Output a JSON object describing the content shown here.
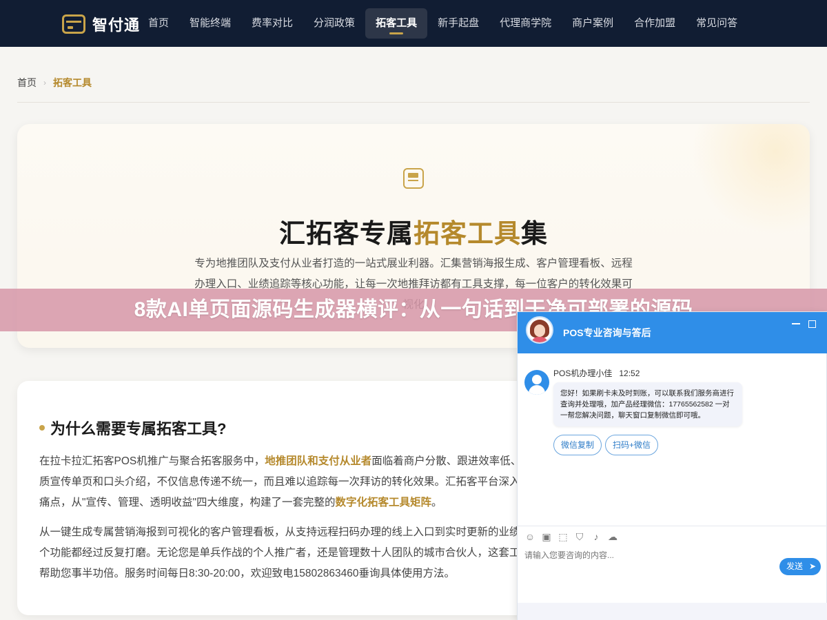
{
  "nav": {
    "brand": "智付通",
    "items": [
      "首页",
      "智能终端",
      "费率对比",
      "分润政策",
      "拓客工具",
      "新手起盘",
      "代理商学院",
      "商户案例",
      "合作加盟",
      "常见问答"
    ],
    "active_index": 4
  },
  "breadcrumb": {
    "home": "首页",
    "separator": "›",
    "current": "拓客工具"
  },
  "hero": {
    "title_prefix": "汇拓客专属",
    "title_highlight": "拓客工具",
    "title_suffix": "集",
    "description": "专为地推团队及支付从业者打造的一站式展业利器。汇集营销海报生成、客户管理看板、远程办理入口、业绩追踪等核心功能，让每一次地推拜访都有工具支撑，每一位客户的转化效果可视化"
  },
  "why": {
    "title": "为什么需要专属拓客工具?",
    "p1_a": "在拉卡拉汇拓客POS机推广与聚合拓客服务中，",
    "p1_hl1": "地推团队和支付从业者",
    "p1_b": "面临着商户分散、跟进效率低、缺乏优质宣传单页和口头介绍，不仅信息传递不统一，而且难以追踪每一次拜访的转化效果。汇拓客平台深入洞察业务痛点，从\"宣传、管理、透明收益\"四大维度，构建了一套完整的",
    "p1_hl2": "数字化拓客工具矩阵",
    "p1_c": "。",
    "p2": "从一键生成专属营销海报到可视化的客户管理看板，从支持远程扫码办理的线上入口到实时更新的业绩数据，每个功能都经过反复打磨。无论您是单兵作战的个人推广者，还是管理数十人团队的城市合伙人，这套工具集都能帮助您事半功倍。服务时间每日8:30-20:00，欢迎致电15802863460垂询具体使用方法。"
  },
  "banner": {
    "text": "8款AI单页面源码生成器横评：从一句话到干净可部署的源码"
  },
  "chat": {
    "title": "POS专业咨询与答后",
    "sender": "POS机办理小佳",
    "time": "12:52",
    "message": "您好！如果刷卡未及时到账，可以联系我们服务商进行查询并处理哦，加产品经理微信：17765562582 一对一帮您解决问题，聊天窗口复制微信即可哦。",
    "quick_replies": [
      "微信复制",
      "扫码+微信"
    ],
    "input_placeholder": "请输入您要咨询的内容...",
    "send_label": "发送",
    "tool_icons": [
      "emoji-icon",
      "image-icon",
      "screenshot-icon",
      "shield-icon",
      "voice-icon",
      "wechat-icon"
    ]
  },
  "colors": {
    "nav_bg": "#111d33",
    "gold": "#b5892c",
    "chat_blue": "#2f8ee8",
    "banner_pink": "#d696a8"
  }
}
